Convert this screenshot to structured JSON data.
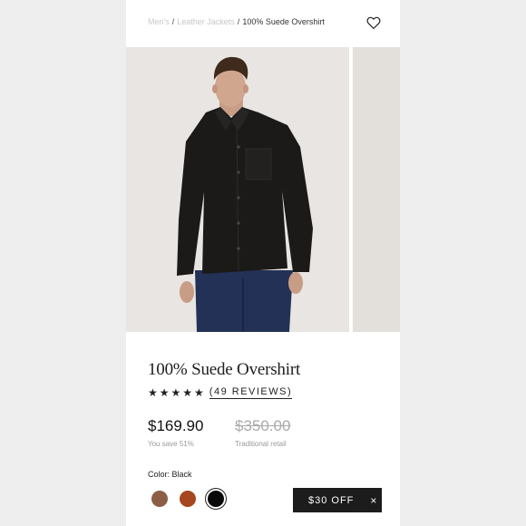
{
  "breadcrumb": {
    "items": [
      "Men's",
      "Leather Jackets"
    ],
    "separator": "/",
    "current": "100% Suede Overshirt"
  },
  "product": {
    "title": "100% Suede Overshirt",
    "rating": 5,
    "stars": "★★★★★",
    "reviews": "(49 REVIEWS)",
    "price": "$169.90",
    "save_text": "You save 51%",
    "retail_price": "$350.00",
    "retail_label": "Traditional retail"
  },
  "color": {
    "label": "Color: Black",
    "swatches": [
      {
        "name": "Brown",
        "hex": "#8b5e45"
      },
      {
        "name": "Rust",
        "hex": "#a5471f"
      },
      {
        "name": "Black",
        "hex": "#0a0a0a",
        "selected": true
      }
    ]
  },
  "promo": {
    "label": "$30 OFF",
    "close": "×"
  },
  "icons": {
    "wishlist": "heart-outline-icon",
    "close": "close-icon"
  },
  "colors": {
    "page_bg": "#eeeeee",
    "photo_bg": "#e8e5e2",
    "promo_bg": "#1c1c1c"
  }
}
